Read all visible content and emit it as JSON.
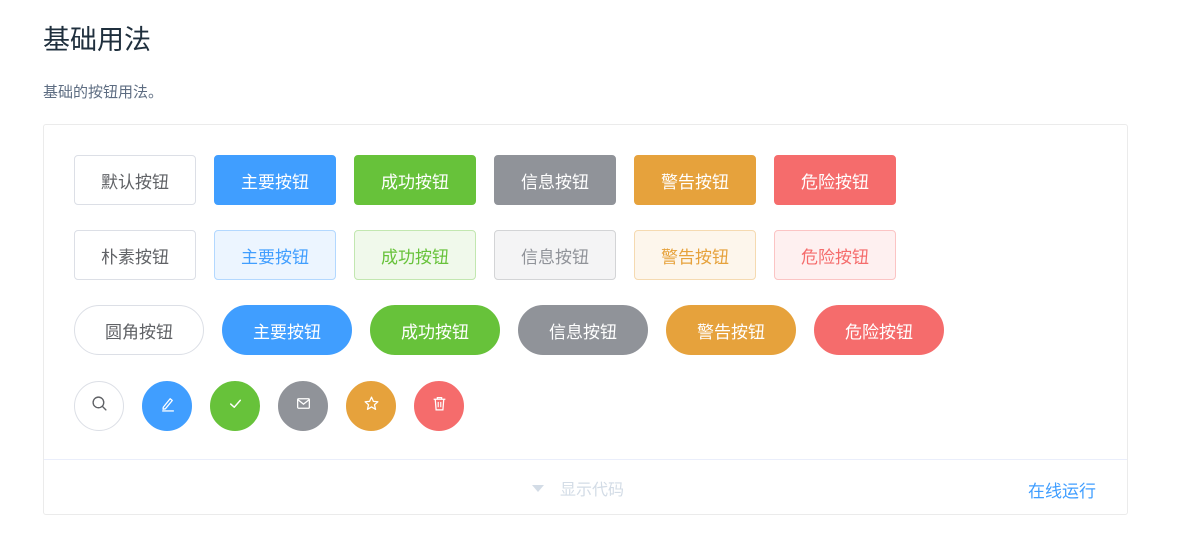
{
  "title": "基础用法",
  "description": "基础的按钮用法。",
  "rows": {
    "default": [
      "默认按钮",
      "主要按钮",
      "成功按钮",
      "信息按钮",
      "警告按钮",
      "危险按钮"
    ],
    "plain": [
      "朴素按钮",
      "主要按钮",
      "成功按钮",
      "信息按钮",
      "警告按钮",
      "危险按钮"
    ],
    "round": [
      "圆角按钮",
      "主要按钮",
      "成功按钮",
      "信息按钮",
      "警告按钮",
      "危险按钮"
    ],
    "circle_icons": [
      "search-icon",
      "edit-icon",
      "check-icon",
      "message-icon",
      "star-icon",
      "delete-icon"
    ]
  },
  "colors": {
    "primary": "#409eff",
    "success": "#67c23a",
    "info": "#909399",
    "warning": "#e6a23c",
    "danger": "#f56c6c"
  },
  "footer": {
    "toggle_label": "显示代码",
    "run_label": "在线运行"
  }
}
